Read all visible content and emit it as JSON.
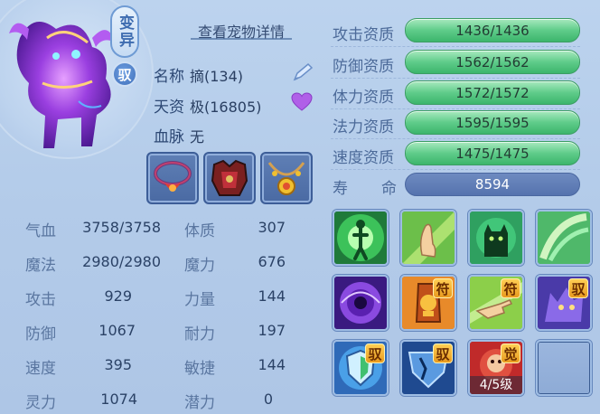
{
  "pet": {
    "variant_tag": "变异",
    "bound_tag": "驭",
    "detail_link": "查看宠物详情",
    "name_label": "名称",
    "name_value": "摘(134)",
    "talent_label": "天资",
    "talent_value": "极(16805)",
    "bloodline_label": "血脉",
    "bloodline_value": "无"
  },
  "equipment": [
    {
      "name": "necklace-red"
    },
    {
      "name": "armor-red"
    },
    {
      "name": "necklace-gold"
    }
  ],
  "stats": {
    "hp_label": "气血",
    "hp_value": "3758/3758",
    "mp_label": "魔法",
    "mp_value": "2980/2980",
    "atk_label": "攻击",
    "atk_value": "929",
    "def_label": "防御",
    "def_value": "1067",
    "spd_label": "速度",
    "spd_value": "395",
    "spirit_label": "灵力",
    "spirit_value": "1074",
    "con_label": "体质",
    "con_value": "307",
    "mag_label": "魔力",
    "mag_value": "676",
    "str_label": "力量",
    "str_value": "144",
    "end_label": "耐力",
    "end_value": "197",
    "agi_label": "敏捷",
    "agi_value": "144",
    "pot_label": "潜力",
    "pot_value": "0"
  },
  "aptitudes": [
    {
      "label": "攻击资质",
      "value": "1436/1436"
    },
    {
      "label": "防御资质",
      "value": "1562/1562"
    },
    {
      "label": "体力资质",
      "value": "1572/1572"
    },
    {
      "label": "法力资质",
      "value": "1595/1595"
    },
    {
      "label": "速度资质",
      "value": "1475/1475"
    }
  ],
  "life": {
    "label_left": "寿",
    "label_right": "命",
    "value": "8594"
  },
  "skills": [
    {
      "icon": "green-figure-icon"
    },
    {
      "icon": "praying-hand-icon"
    },
    {
      "icon": "green-cat-icon"
    },
    {
      "icon": "green-swirl-icon"
    },
    {
      "icon": "purple-vortex-icon"
    },
    {
      "icon": "golden-talisman-icon",
      "badge": "符"
    },
    {
      "icon": "pointing-hand-icon",
      "badge": "符"
    },
    {
      "icon": "purple-wolf-icon",
      "badge": "驭"
    },
    {
      "icon": "blue-shield-icon",
      "badge": "驭"
    },
    {
      "icon": "broken-shield-icon",
      "badge": "驭"
    },
    {
      "icon": "red-monkey-icon",
      "badge": "觉",
      "level": "4/5级"
    }
  ],
  "colors": {
    "background": "#b3cbe9",
    "aptitude_bar": "#5fcc8a",
    "life_bar": "#5573ae",
    "badge": "#f2b43a"
  }
}
